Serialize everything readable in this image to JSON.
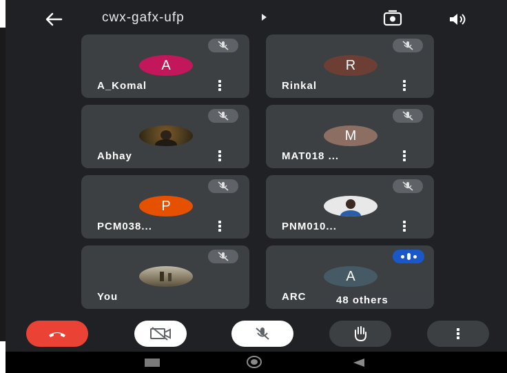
{
  "header": {
    "meeting_code": "cwx-gafx-ufp"
  },
  "participants": [
    {
      "name": "A_Komal",
      "initial": "A",
      "avatar_color": "#c2185b",
      "muted": true
    },
    {
      "name": "Rinkal",
      "initial": "R",
      "avatar_color": "#6d3f34",
      "muted": true
    },
    {
      "name": "Abhay",
      "initial": "",
      "avatar_color": "#4a3a1e",
      "muted": true,
      "photo": true
    },
    {
      "name": "MAT018 ...",
      "initial": "M",
      "avatar_color": "#8d6e63",
      "muted": true
    },
    {
      "name": "PCM038...",
      "initial": "P",
      "avatar_color": "#e65100",
      "muted": true
    },
    {
      "name": "PNM010...",
      "initial": "",
      "avatar_color": "#d9d9d9",
      "muted": true,
      "photo": true
    },
    {
      "name": "You",
      "initial": "",
      "avatar_color": "#8a8068",
      "muted": true,
      "photo": true
    },
    {
      "name": "ARC",
      "initial": "A",
      "avatar_color": "#455a64",
      "muted": false,
      "speaking": true
    }
  ],
  "others_label": "48 others",
  "controls": {
    "end_call_color": "#ea4335",
    "camera": "camera-off",
    "mic": "mic-off",
    "raise_hand": "raise-hand",
    "more": "more"
  }
}
